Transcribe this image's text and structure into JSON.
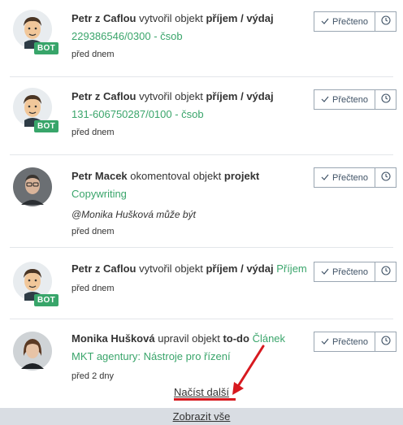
{
  "read_label": "Přečteno",
  "items": [
    {
      "actor": "Petr z Caflou",
      "action": "vytvořil objekt",
      "object_type": "příjem / výdaj",
      "link_inline": "",
      "link": "229386546/0300 - čsob",
      "comment": "",
      "time": "před dnem",
      "bot": "BOT",
      "avatar_icon": "bot-avatar-icon"
    },
    {
      "actor": "Petr z Caflou",
      "action": "vytvořil objekt",
      "object_type": "příjem / výdaj",
      "link_inline": "",
      "link": "131-606750287/0100 - čsob",
      "comment": "",
      "time": "před dnem",
      "bot": "BOT",
      "avatar_icon": "bot-avatar-icon"
    },
    {
      "actor": "Petr Macek",
      "action": "okomentoval objekt",
      "object_type": "projekt",
      "link_inline": "",
      "link": "Copywriting",
      "comment": "@Monika Hušková může být",
      "time": "před dnem",
      "bot": "",
      "avatar_icon": "user-photo-icon"
    },
    {
      "actor": "Petr z Caflou",
      "action": "vytvořil objekt",
      "object_type": "příjem / výdaj",
      "link_inline": "Příjem",
      "link": "",
      "comment": "",
      "time": "před dnem",
      "bot": "BOT",
      "avatar_icon": "bot-avatar-icon"
    },
    {
      "actor": "Monika Hušková",
      "action": "upravil objekt",
      "object_type": "to-do",
      "link_inline": "Článek",
      "link": "MKT agentury: Nástroje pro řízení",
      "comment": "",
      "time": "před 2 dny",
      "bot": "",
      "avatar_icon": "user-photo-icon"
    }
  ],
  "load_more": "Načíst další",
  "show_all": "Zobrazit vše",
  "colors": {
    "green": "#3aa56b",
    "bot_badge": "#38a56a",
    "annotation": "#d7191f",
    "footer_bg": "#d9dde3"
  }
}
